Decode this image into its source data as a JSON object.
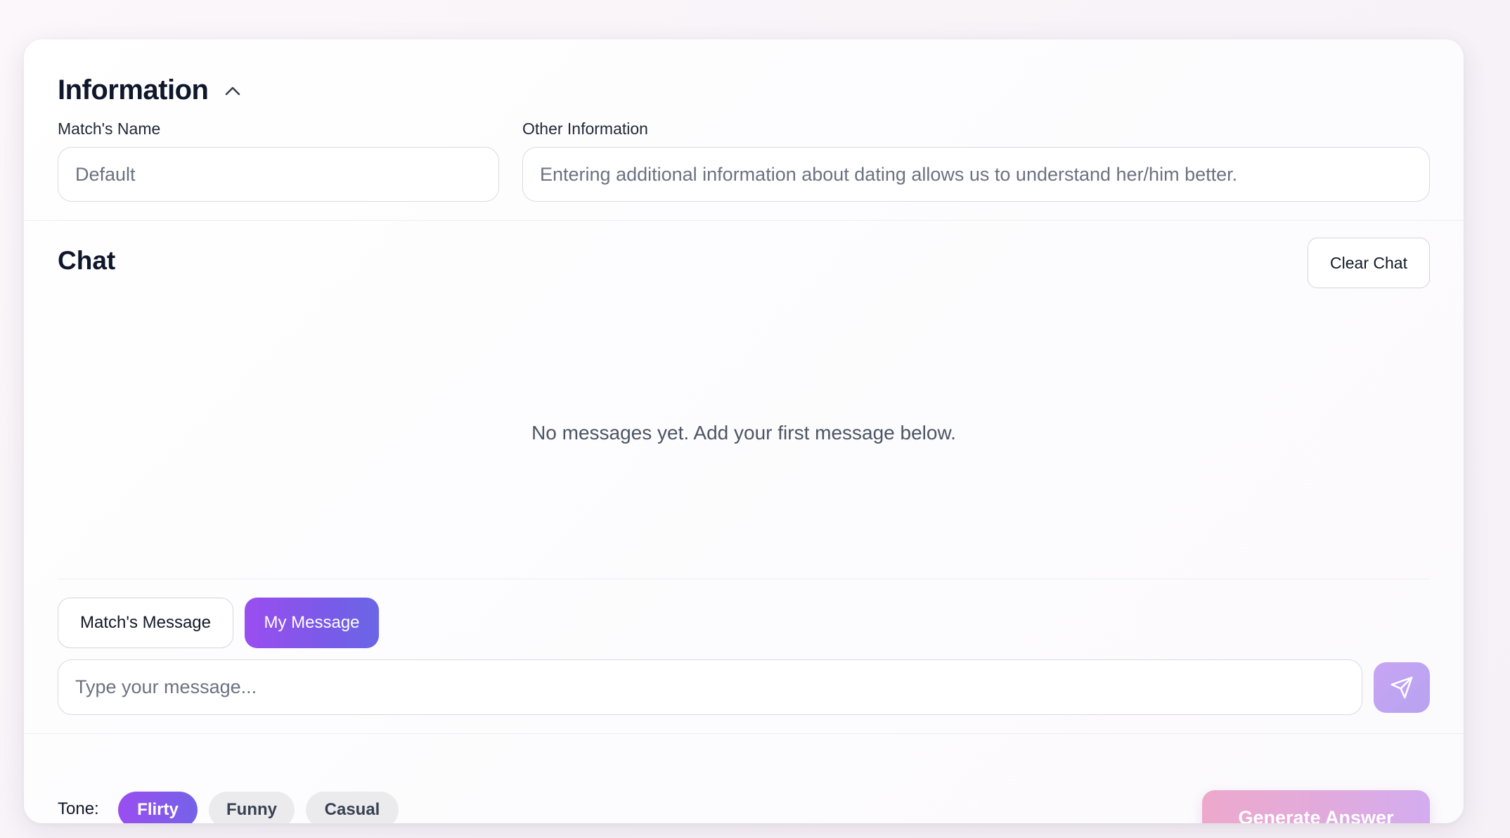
{
  "info": {
    "title": "Information",
    "collapse_icon": "chevron-up-icon",
    "match_name": {
      "label": "Match's Name",
      "placeholder": "Default",
      "value": ""
    },
    "other_info": {
      "label": "Other Information",
      "placeholder": "Entering additional information about dating allows us to understand her/him better.",
      "value": ""
    }
  },
  "chat": {
    "title": "Chat",
    "clear_label": "Clear Chat",
    "empty_text": "No messages yet. Add your first message below.",
    "roles": {
      "match_label": "Match's Message",
      "mine_label": "My Message",
      "selected": "My Message"
    },
    "input": {
      "placeholder": "Type your message...",
      "value": ""
    },
    "send_icon": "send-icon"
  },
  "footer": {
    "tone_label": "Tone:",
    "tones": [
      {
        "label": "Flirty",
        "active": true
      },
      {
        "label": "Funny",
        "active": false
      },
      {
        "label": "Casual",
        "active": false
      }
    ],
    "generate_label": "Generate Answer"
  },
  "colors": {
    "accent_purple": "#8b5cf6",
    "accent_gradient_start": "#9a4ef0",
    "accent_gradient_end": "#6a66e6",
    "generate_gradient_start": "#eda9cc",
    "generate_gradient_end": "#d3acf0"
  }
}
